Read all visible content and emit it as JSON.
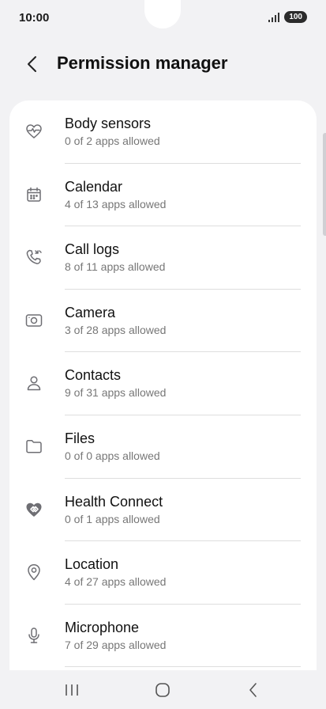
{
  "status_bar": {
    "time": "10:00",
    "battery": "100"
  },
  "header": {
    "title": "Permission manager"
  },
  "permissions": [
    {
      "label": "Body sensors",
      "sub": "0 of 2 apps allowed",
      "icon": "heart-pulse-icon"
    },
    {
      "label": "Calendar",
      "sub": "4 of 13 apps allowed",
      "icon": "calendar-icon"
    },
    {
      "label": "Call logs",
      "sub": "8 of 11 apps allowed",
      "icon": "phone-log-icon"
    },
    {
      "label": "Camera",
      "sub": "3 of 28 apps allowed",
      "icon": "camera-icon"
    },
    {
      "label": "Contacts",
      "sub": "9 of 31 apps allowed",
      "icon": "person-icon"
    },
    {
      "label": "Files",
      "sub": "0 of 0 apps allowed",
      "icon": "folder-icon"
    },
    {
      "label": "Health Connect",
      "sub": "0 of 1 apps allowed",
      "icon": "health-connect-icon"
    },
    {
      "label": "Location",
      "sub": "4 of 27 apps allowed",
      "icon": "location-pin-icon"
    },
    {
      "label": "Microphone",
      "sub": "7 of 29 apps allowed",
      "icon": "microphone-icon"
    }
  ],
  "colors": {
    "background": "#f2f2f4",
    "card": "#ffffff",
    "icon": "#6e6e73",
    "subtitle": "#777777"
  }
}
